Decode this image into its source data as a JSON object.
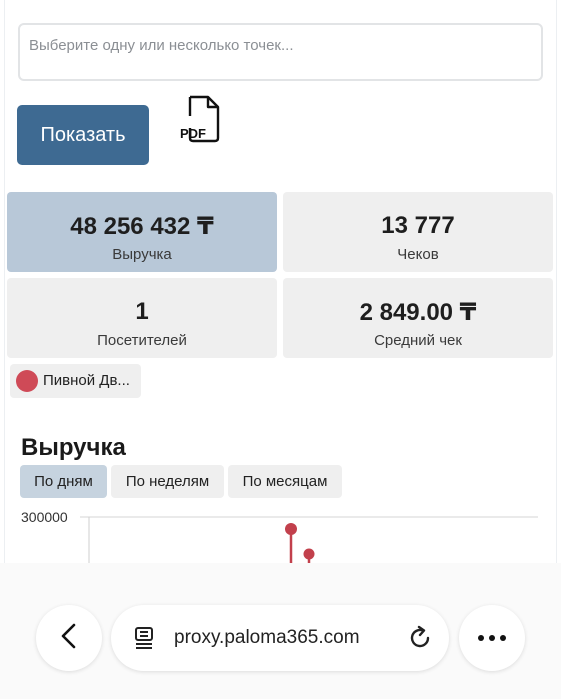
{
  "filter": {
    "placeholder": "Выберите одну или несколько точек..."
  },
  "actions": {
    "show_label": "Показать",
    "pdf_label": "PDF"
  },
  "stats": [
    {
      "value": "48 256 432 ₸",
      "label": "Выручка",
      "active": true
    },
    {
      "value": "13 777",
      "label": "Чеков",
      "active": false
    },
    {
      "value": "1",
      "label": "Посетителей",
      "active": false
    },
    {
      "value": "2 849.00 ₸",
      "label": "Средний чек",
      "active": false
    }
  ],
  "store_chip": {
    "label": "Пивной Дв...",
    "color": "#cf4a57"
  },
  "section": {
    "title": "Выручка",
    "tabs": [
      {
        "label": "По дням",
        "active": true
      },
      {
        "label": "По неделям",
        "active": false
      },
      {
        "label": "По месяцам",
        "active": false
      }
    ]
  },
  "chart_data": {
    "type": "line",
    "y_tick_labels": [
      "300000"
    ],
    "series_color": "#c2404c",
    "visible_points_note": ""
  },
  "browser": {
    "url": "proxy.paloma365.com",
    "back_icon": "chevron-left-icon",
    "reader_icon": "reader-mode-icon",
    "reload_icon": "reload-icon",
    "more_icon": "more-dots-icon"
  }
}
